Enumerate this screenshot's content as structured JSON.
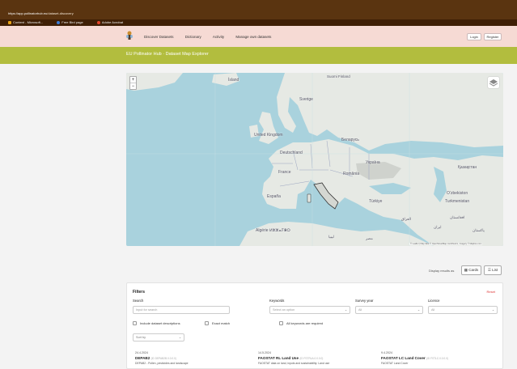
{
  "browser": {
    "url_host": "https://app.pollinatorhub.eu",
    "url_path": "/dataset-discovery",
    "bookmarks": [
      {
        "label": "Content - Microsoft...",
        "color": "#e8a317"
      },
      {
        "label": "Free Bird page",
        "color": "#3a7bd5"
      },
      {
        "label": "Adobe Acrobat",
        "color": "#e4452b"
      }
    ]
  },
  "nav": {
    "items": [
      "Discover Datasets",
      "Dictionary",
      "Activity",
      "Manage own datasets"
    ],
    "login": "Login",
    "register": "Register"
  },
  "page": {
    "title": "EU Pollinator Hub · Dataset Map Explorer"
  },
  "map": {
    "zoom_in": "+",
    "zoom_out": "−",
    "labels": {
      "island": "Ísland",
      "suomi": "Suomi Finland",
      "sverige": "Sverige",
      "uk": "United Kingdom",
      "deutschland": "Deutschland",
      "belarus": "Беларусь",
      "ukraina": "Україна",
      "kazakhstan": "Қазақстан",
      "france": "France",
      "romania": "România",
      "espana": "España",
      "turkiye": "Türkiye",
      "uzbekiston": "O‘zbekiston",
      "turkmenistan": "Turkmenistan",
      "algerie": "Algérie ⵍⵣⵣⴰⵢⴻⵔ",
      "iraq": "العراق",
      "iran": "ایران",
      "afghanistan": "افغانستان",
      "pakistan": "پاکستان",
      "libya": "ليبيا",
      "egypt": "مصر"
    },
    "attribution": "© Leaflet | Map data © OpenStreetMap contributors, Imagery © Mapbox.com"
  },
  "display": {
    "label": "Display results as",
    "cards": "Cards",
    "list": "List"
  },
  "filters": {
    "title": "Filters",
    "reset": "Reset",
    "search_label": "Search",
    "search_placeholder": "Input for search",
    "keywords_label": "Keywords",
    "keywords_placeholder": "Select an option",
    "survey_year_label": "Survey year",
    "survey_year_value": "All",
    "licence_label": "Licence",
    "licence_value": "All",
    "include_desc": "Include dataset descriptions",
    "exact_match": "Exact match",
    "all_keywords": "All keywords are required",
    "sort_by": "Sort by"
  },
  "cards": [
    {
      "date": "24.4.2024",
      "name": "DEPAB2",
      "id": "(ID DEPAB2B.0.0.0.0)",
      "desc": "DEPAB2 - Pollen, pesticides and landscape"
    },
    {
      "date": "14.5.2024",
      "name": "FAOSTAT RL Land Use",
      "id": "(ID FSTRLA.0.0.0.0)",
      "desc": "FAOSTAT data on land, inputs and sustainability: Land use"
    },
    {
      "date": "9.4.2024",
      "name": "FAOSTAT LC Land Cover",
      "id": "(ID FSTLC.0.0.0.0)",
      "desc": "FAOSTAT Land Cover"
    }
  ],
  "colors": {
    "browser_bar": "#5a3410",
    "appbar": "#f6dad4",
    "accent_green": "#b2bd3e",
    "sea": "#a9d2dd",
    "land": "#e6e9e4",
    "reset": "#dd3333"
  }
}
